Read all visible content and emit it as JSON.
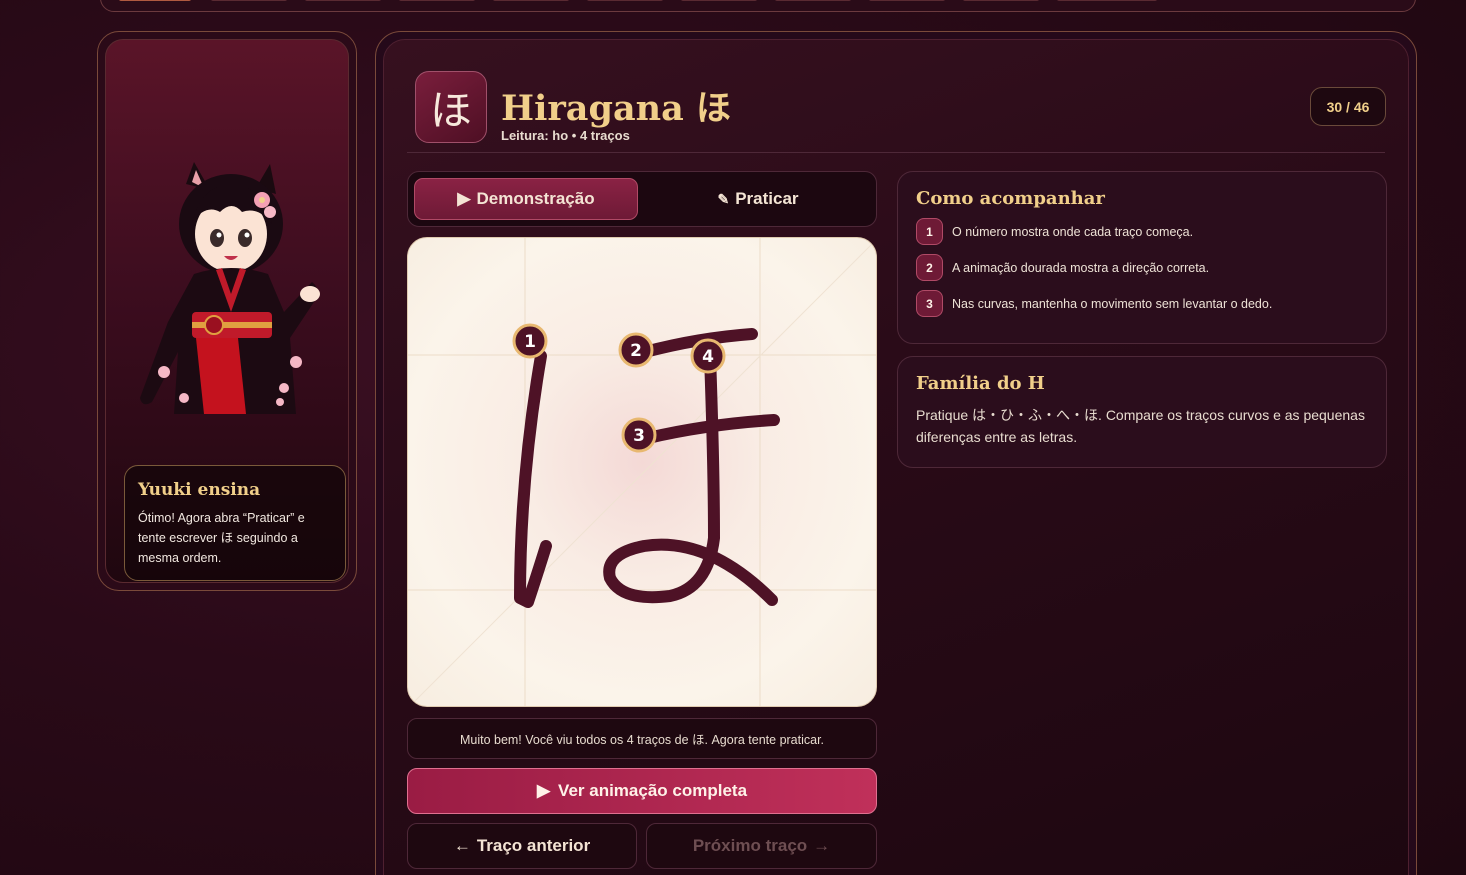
{
  "kana": {
    "glyph": "ほ"
  },
  "header": {
    "title": "Hiragana ほ",
    "subtitle": "Leitura: ho • 4 traços",
    "progress": "30 / 46"
  },
  "tutor": {
    "name": "Yuuki ensina",
    "message": "Ótimo! Agora abra “Praticar” e tente escrever ほ seguindo a mesma ordem."
  },
  "tabs": [
    {
      "label": "Demonstração",
      "icon": "play-icon",
      "active": true
    },
    {
      "label": "Praticar",
      "icon": "pencil-icon",
      "active": false
    }
  ],
  "stroke_markers": [
    "1",
    "2",
    "3",
    "4"
  ],
  "status": "Muito bem! Você viu todos os 4 traços de ほ. Agora tente praticar.",
  "actions": {
    "play_all": "Ver animação completa",
    "prev": "Traço anterior",
    "next": "Próximo traço"
  },
  "guide": {
    "title": "Como acompanhar",
    "steps": [
      {
        "num": "1",
        "text": "O número mostra onde cada traço começa."
      },
      {
        "num": "2",
        "text": "A animação dourada mostra a direção correta."
      },
      {
        "num": "3",
        "text": "Nas curvas, mantenha o movimento sem levantar o dedo."
      }
    ]
  },
  "family": {
    "title": "Família do H",
    "text": "Pratique は・ひ・ふ・へ・ほ. Compare os traços curvos e as pequenas diferenças entre as letras."
  },
  "colors": {
    "accent": "#f1cf8a",
    "primary": "#8a2244",
    "stroke": "#4e1226",
    "background": "#2a0a18"
  }
}
